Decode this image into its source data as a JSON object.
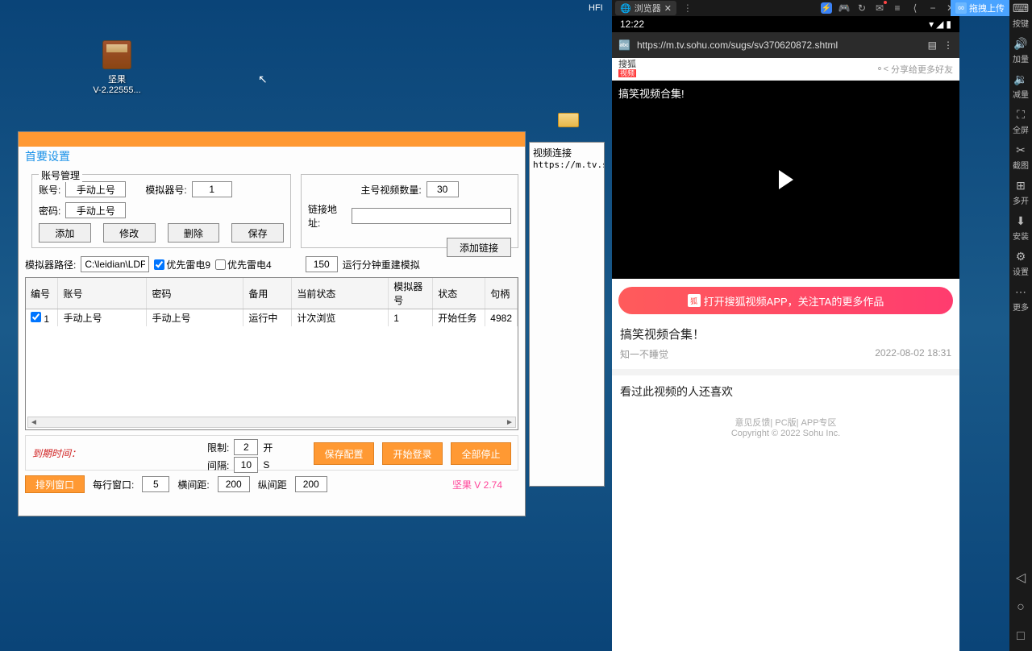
{
  "desktop": {
    "icon_name": "坚果",
    "icon_sub": "V-2.22555..."
  },
  "hfi": "HFI",
  "app": {
    "title": "首要设置",
    "account_mgmt": "账号管理",
    "account_label": "账号:",
    "account_value": "手动上号",
    "password_label": "密码:",
    "password_value": "手动上号",
    "emulator_no_label": "模拟器号:",
    "emulator_no_value": "1",
    "btn_add": "添加",
    "btn_modify": "修改",
    "btn_delete": "删除",
    "btn_save": "保存",
    "main_video_count_label": "主号视频数量:",
    "main_video_count_value": "30",
    "link_addr_label": "链接地址:",
    "link_addr_value": "",
    "btn_add_link": "添加链接",
    "emulator_path_label": "模拟器路径:",
    "emulator_path_value": "C:\\leidian\\LDPla",
    "priority_leidian9": "优先雷电9",
    "priority_leidian4": "优先雷电4",
    "rebuild_minutes_value": "150",
    "rebuild_minutes_label": "运行分钟重建模拟",
    "table": {
      "cols": [
        "编号",
        "账号",
        "密码",
        "备用",
        "当前状态",
        "模拟器号",
        "状态",
        "句柄"
      ],
      "row": {
        "no": "1",
        "account": "手动上号",
        "password": "手动上号",
        "backup": "运行中",
        "status": "计次浏览",
        "emu_no": "1",
        "state": "开始任务",
        "handle": "4982"
      }
    },
    "expire_label": "到期时间：",
    "limit_label": "限制:",
    "limit_value": "2",
    "limit_unit": "开",
    "interval_label": "间隔:",
    "interval_value": "10",
    "interval_unit": "S",
    "btn_save_config": "保存配置",
    "btn_start_login": "开始登录",
    "btn_stop_all": "全部停止",
    "btn_arrange": "排列窗口",
    "per_window_label": "每行窗口:",
    "per_window_value": "5",
    "h_gap_label": "横间距:",
    "h_gap_value": "200",
    "v_gap_label": "纵间距",
    "v_gap_value": "200",
    "version": "坚果   V 2.74"
  },
  "side": {
    "title": "视频连接",
    "url": "https://m.tv.sohu."
  },
  "emulator": {
    "tab_label": "浏览器",
    "time": "12:22",
    "url": "https://m.tv.sohu.com/sugs/sv370620872.shtml",
    "sohu_text": "搜狐",
    "sohu_badge": "视频",
    "share": "分享给更多好友",
    "video_title": "搞笑视频合集!",
    "open_app": "打开搜狐视频APP，关注TA的更多作品",
    "title2": "搞笑视频合集！",
    "author": "知一不睡觉",
    "date": "2022-08-02 18:31",
    "related": "看过此视频的人还喜欢",
    "footer_links": "意见反馈| PC版| APP专区",
    "copyright": "Copyright © 2022 Sohu Inc."
  },
  "cloud_btn": "拖拽上传",
  "rs": {
    "keys": "按键",
    "vol_up": "加量",
    "vol_down": "减量",
    "fullscreen": "全屏",
    "screenshot": "截图",
    "multi": "多开",
    "install": "安装",
    "settings": "设置",
    "more": "更多"
  }
}
